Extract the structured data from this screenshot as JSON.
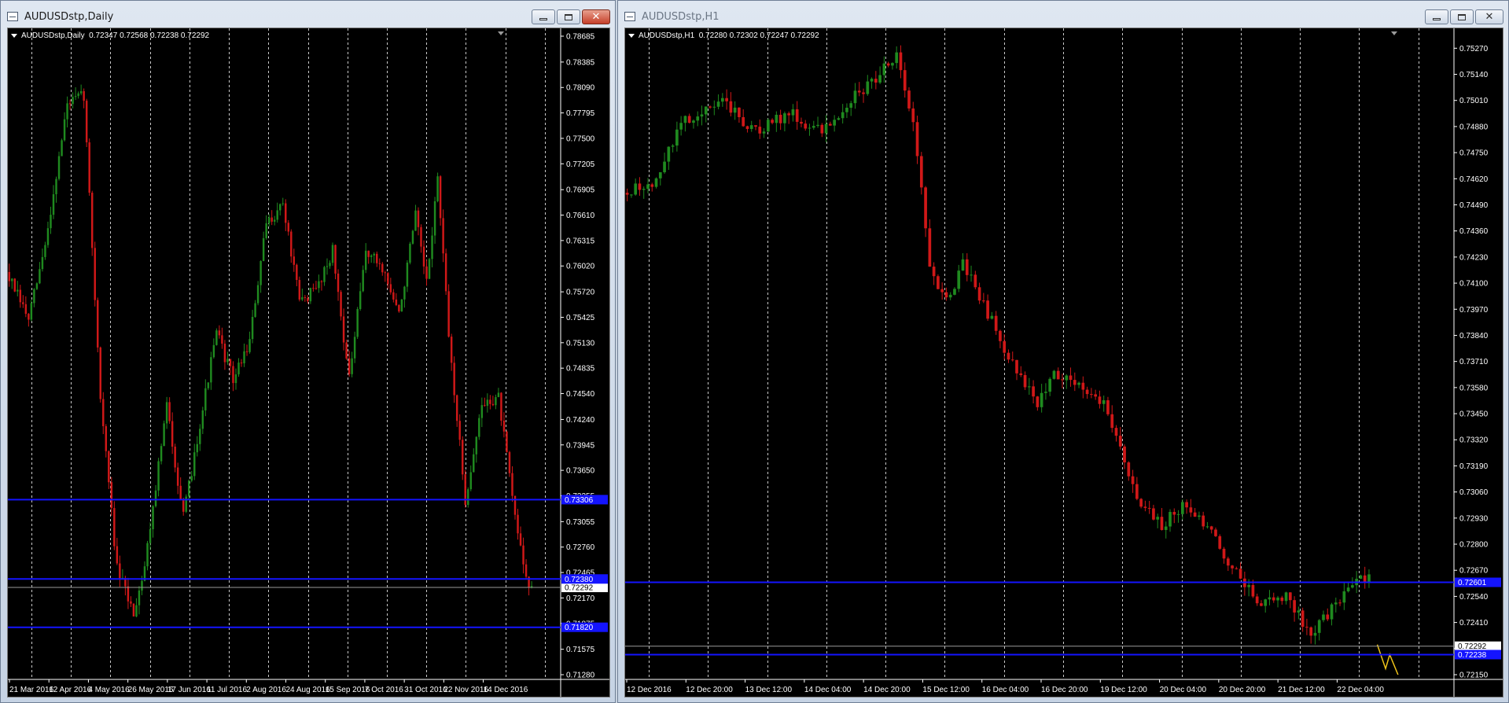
{
  "colors": {
    "background": "#000000",
    "grid": "#c8c8c8",
    "bull": "#1f8a1f",
    "bear": "#d01818",
    "hline": "#1414ff",
    "label_current": "#ffffff",
    "zigzag": "#f0c419"
  },
  "windows": [
    {
      "title": "AUDUSDstp,Daily",
      "info": {
        "symbol": "AUDUSDstp,Daily",
        "ohlc": "0.72347 0.72568 0.72238 0.72292"
      },
      "chart_data": {
        "type": "candlestick",
        "symbol": "AUDUSDstp",
        "timeframe": "Daily",
        "ylim": [
          0.7128,
          0.78685
        ],
        "y_ticks": [
          "0.78685",
          "0.78385",
          "0.78090",
          "0.77795",
          "0.77500",
          "0.77205",
          "0.76905",
          "0.76610",
          "0.76315",
          "0.76020",
          "0.75720",
          "0.75425",
          "0.75130",
          "0.74835",
          "0.74540",
          "0.74240",
          "0.73945",
          "0.73650",
          "0.73355",
          "0.73055",
          "0.72760",
          "0.72465",
          "0.72170",
          "0.71875",
          "0.71575",
          "0.71280"
        ],
        "x_ticks": [
          "21 Mar 2016",
          "12 Apr 2016",
          "4 May 2016",
          "26 May 2016",
          "17 Jun 2016",
          "11 Jul 2016",
          "2 Aug 2016",
          "24 Aug 2016",
          "15 Sep 2016",
          "7 Oct 2016",
          "31 Oct 2016",
          "22 Nov 2016",
          "14 Dec 2016"
        ],
        "bars": 200,
        "visible_candles": 190,
        "anchors": [
          [
            0,
            0.7595
          ],
          [
            8,
            0.754
          ],
          [
            14,
            0.7625
          ],
          [
            22,
            0.779
          ],
          [
            28,
            0.78
          ],
          [
            34,
            0.745
          ],
          [
            40,
            0.725
          ],
          [
            46,
            0.72
          ],
          [
            50,
            0.7255
          ],
          [
            58,
            0.744
          ],
          [
            64,
            0.731
          ],
          [
            70,
            0.742
          ],
          [
            76,
            0.7525
          ],
          [
            82,
            0.747
          ],
          [
            88,
            0.7515
          ],
          [
            94,
            0.765
          ],
          [
            100,
            0.7675
          ],
          [
            106,
            0.756
          ],
          [
            112,
            0.7575
          ],
          [
            118,
            0.762
          ],
          [
            124,
            0.747
          ],
          [
            130,
            0.762
          ],
          [
            136,
            0.76
          ],
          [
            142,
            0.7545
          ],
          [
            148,
            0.766
          ],
          [
            152,
            0.758
          ],
          [
            156,
            0.7705
          ],
          [
            160,
            0.752
          ],
          [
            166,
            0.733
          ],
          [
            172,
            0.744
          ],
          [
            178,
            0.745
          ],
          [
            184,
            0.731
          ],
          [
            189,
            0.7229
          ]
        ],
        "seed": 7,
        "last_price": "0.72292",
        "hlines": [
          {
            "value": 0.7331,
            "label": "0.73306"
          },
          {
            "value": 0.7239,
            "label": "0.72380"
          },
          {
            "value": 0.7183,
            "label": "0.71820"
          }
        ],
        "current_line": 0.72292,
        "zigzag": []
      }
    },
    {
      "title": "AUDUSDstp,H1",
      "info": {
        "symbol": "AUDUSDstp,H1",
        "ohlc": "0.72280 0.72302 0.72247 0.72292"
      },
      "chart_data": {
        "type": "candlestick",
        "symbol": "AUDUSDstp",
        "timeframe": "H1",
        "ylim": [
          0.7215,
          0.7533
        ],
        "y_ticks": [
          "0.75270",
          "0.75140",
          "0.75010",
          "0.74880",
          "0.74750",
          "0.74620",
          "0.74490",
          "0.74360",
          "0.74230",
          "0.74100",
          "0.73970",
          "0.73840",
          "0.73710",
          "0.73580",
          "0.73450",
          "0.73320",
          "0.73190",
          "0.73060",
          "0.72930",
          "0.72800",
          "0.72670",
          "0.72540",
          "0.72410",
          "0.72280",
          "0.72150"
        ],
        "x_ticks": [
          "12 Dec 2016",
          "12 Dec 20:00",
          "13 Dec 12:00",
          "14 Dec 04:00",
          "14 Dec 20:00",
          "15 Dec 12:00",
          "16 Dec 04:00",
          "16 Dec 20:00",
          "19 Dec 12:00",
          "20 Dec 04:00",
          "20 Dec 20:00",
          "21 Dec 12:00",
          "22 Dec 04:00"
        ],
        "bars": 200,
        "visible_candles": 180,
        "anchors": [
          [
            0,
            0.7455
          ],
          [
            8,
            0.746
          ],
          [
            14,
            0.749
          ],
          [
            24,
            0.75
          ],
          [
            32,
            0.7485
          ],
          [
            40,
            0.7495
          ],
          [
            48,
            0.7485
          ],
          [
            54,
            0.75
          ],
          [
            60,
            0.751
          ],
          [
            66,
            0.7525
          ],
          [
            70,
            0.749
          ],
          [
            74,
            0.742
          ],
          [
            78,
            0.74
          ],
          [
            82,
            0.742
          ],
          [
            88,
            0.7395
          ],
          [
            94,
            0.737
          ],
          [
            100,
            0.735
          ],
          [
            104,
            0.7365
          ],
          [
            110,
            0.736
          ],
          [
            116,
            0.735
          ],
          [
            120,
            0.733
          ],
          [
            124,
            0.73
          ],
          [
            130,
            0.729
          ],
          [
            136,
            0.73
          ],
          [
            142,
            0.7285
          ],
          [
            148,
            0.7265
          ],
          [
            154,
            0.725
          ],
          [
            160,
            0.7255
          ],
          [
            166,
            0.7235
          ],
          [
            172,
            0.725
          ],
          [
            178,
            0.7265
          ],
          [
            184,
            0.726
          ],
          [
            188,
            0.727
          ],
          [
            194,
            0.7245
          ],
          [
            200,
            0.7255
          ],
          [
            206,
            0.725
          ],
          [
            212,
            0.724
          ],
          [
            216,
            0.7245
          ],
          [
            220,
            0.723
          ],
          [
            224,
            0.724
          ],
          [
            226,
            0.7238
          ]
        ],
        "seed": 13,
        "last_price": "0.72292",
        "hlines": [
          {
            "value": 0.7261,
            "label": "0.72601"
          },
          {
            "value": 0.7225,
            "label": "0.72238"
          }
        ],
        "current_line": 0.72292,
        "zigzag": [
          [
            181,
            0.723
          ],
          [
            183,
            0.7218
          ],
          [
            184,
            0.7225
          ],
          [
            186,
            0.7215
          ]
        ]
      }
    }
  ]
}
